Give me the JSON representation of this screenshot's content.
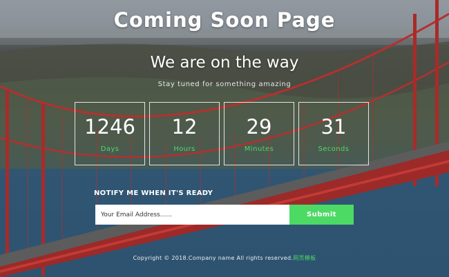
{
  "page_title": "Coming Soon Page",
  "headline": "We are on the way",
  "tagline": "Stay tuned for something amazing",
  "countdown": [
    {
      "value": "1246",
      "label": "Days"
    },
    {
      "value": "12",
      "label": "Hours"
    },
    {
      "value": "29",
      "label": "Minutes"
    },
    {
      "value": "31",
      "label": "Seconds"
    }
  ],
  "notify": {
    "label": "NOTIFY ME WHEN IT'S READY",
    "email_placeholder": "Your Email Address......",
    "submit_label": "Submit"
  },
  "footer": {
    "text": "Copyright © 2018.Company name All rights reserved.",
    "link_text": "网页模板"
  },
  "colors": {
    "accent": "#4cd964",
    "bridge": "#b5302e"
  }
}
